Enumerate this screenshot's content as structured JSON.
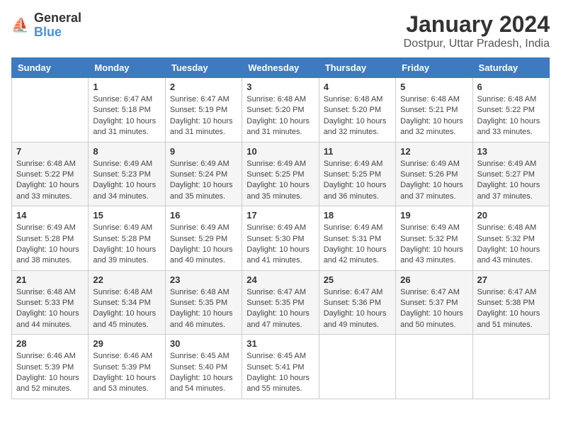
{
  "logo": {
    "text_general": "General",
    "text_blue": "Blue"
  },
  "title": "January 2024",
  "subtitle": "Dostpur, Uttar Pradesh, India",
  "headers": [
    "Sunday",
    "Monday",
    "Tuesday",
    "Wednesday",
    "Thursday",
    "Friday",
    "Saturday"
  ],
  "weeks": [
    {
      "days": [
        {
          "number": "",
          "info": ""
        },
        {
          "number": "1",
          "info": "Sunrise: 6:47 AM\nSunset: 5:18 PM\nDaylight: 10 hours and 31 minutes."
        },
        {
          "number": "2",
          "info": "Sunrise: 6:47 AM\nSunset: 5:19 PM\nDaylight: 10 hours and 31 minutes."
        },
        {
          "number": "3",
          "info": "Sunrise: 6:48 AM\nSunset: 5:20 PM\nDaylight: 10 hours and 31 minutes."
        },
        {
          "number": "4",
          "info": "Sunrise: 6:48 AM\nSunset: 5:20 PM\nDaylight: 10 hours and 32 minutes."
        },
        {
          "number": "5",
          "info": "Sunrise: 6:48 AM\nSunset: 5:21 PM\nDaylight: 10 hours and 32 minutes."
        },
        {
          "number": "6",
          "info": "Sunrise: 6:48 AM\nSunset: 5:22 PM\nDaylight: 10 hours and 33 minutes."
        }
      ]
    },
    {
      "days": [
        {
          "number": "7",
          "info": "Sunrise: 6:48 AM\nSunset: 5:22 PM\nDaylight: 10 hours and 33 minutes."
        },
        {
          "number": "8",
          "info": "Sunrise: 6:49 AM\nSunset: 5:23 PM\nDaylight: 10 hours and 34 minutes."
        },
        {
          "number": "9",
          "info": "Sunrise: 6:49 AM\nSunset: 5:24 PM\nDaylight: 10 hours and 35 minutes."
        },
        {
          "number": "10",
          "info": "Sunrise: 6:49 AM\nSunset: 5:25 PM\nDaylight: 10 hours and 35 minutes."
        },
        {
          "number": "11",
          "info": "Sunrise: 6:49 AM\nSunset: 5:25 PM\nDaylight: 10 hours and 36 minutes."
        },
        {
          "number": "12",
          "info": "Sunrise: 6:49 AM\nSunset: 5:26 PM\nDaylight: 10 hours and 37 minutes."
        },
        {
          "number": "13",
          "info": "Sunrise: 6:49 AM\nSunset: 5:27 PM\nDaylight: 10 hours and 37 minutes."
        }
      ]
    },
    {
      "days": [
        {
          "number": "14",
          "info": "Sunrise: 6:49 AM\nSunset: 5:28 PM\nDaylight: 10 hours and 38 minutes."
        },
        {
          "number": "15",
          "info": "Sunrise: 6:49 AM\nSunset: 5:28 PM\nDaylight: 10 hours and 39 minutes."
        },
        {
          "number": "16",
          "info": "Sunrise: 6:49 AM\nSunset: 5:29 PM\nDaylight: 10 hours and 40 minutes."
        },
        {
          "number": "17",
          "info": "Sunrise: 6:49 AM\nSunset: 5:30 PM\nDaylight: 10 hours and 41 minutes."
        },
        {
          "number": "18",
          "info": "Sunrise: 6:49 AM\nSunset: 5:31 PM\nDaylight: 10 hours and 42 minutes."
        },
        {
          "number": "19",
          "info": "Sunrise: 6:49 AM\nSunset: 5:32 PM\nDaylight: 10 hours and 43 minutes."
        },
        {
          "number": "20",
          "info": "Sunrise: 6:48 AM\nSunset: 5:32 PM\nDaylight: 10 hours and 43 minutes."
        }
      ]
    },
    {
      "days": [
        {
          "number": "21",
          "info": "Sunrise: 6:48 AM\nSunset: 5:33 PM\nDaylight: 10 hours and 44 minutes."
        },
        {
          "number": "22",
          "info": "Sunrise: 6:48 AM\nSunset: 5:34 PM\nDaylight: 10 hours and 45 minutes."
        },
        {
          "number": "23",
          "info": "Sunrise: 6:48 AM\nSunset: 5:35 PM\nDaylight: 10 hours and 46 minutes."
        },
        {
          "number": "24",
          "info": "Sunrise: 6:47 AM\nSunset: 5:35 PM\nDaylight: 10 hours and 47 minutes."
        },
        {
          "number": "25",
          "info": "Sunrise: 6:47 AM\nSunset: 5:36 PM\nDaylight: 10 hours and 49 minutes."
        },
        {
          "number": "26",
          "info": "Sunrise: 6:47 AM\nSunset: 5:37 PM\nDaylight: 10 hours and 50 minutes."
        },
        {
          "number": "27",
          "info": "Sunrise: 6:47 AM\nSunset: 5:38 PM\nDaylight: 10 hours and 51 minutes."
        }
      ]
    },
    {
      "days": [
        {
          "number": "28",
          "info": "Sunrise: 6:46 AM\nSunset: 5:39 PM\nDaylight: 10 hours and 52 minutes."
        },
        {
          "number": "29",
          "info": "Sunrise: 6:46 AM\nSunset: 5:39 PM\nDaylight: 10 hours and 53 minutes."
        },
        {
          "number": "30",
          "info": "Sunrise: 6:45 AM\nSunset: 5:40 PM\nDaylight: 10 hours and 54 minutes."
        },
        {
          "number": "31",
          "info": "Sunrise: 6:45 AM\nSunset: 5:41 PM\nDaylight: 10 hours and 55 minutes."
        },
        {
          "number": "",
          "info": ""
        },
        {
          "number": "",
          "info": ""
        },
        {
          "number": "",
          "info": ""
        }
      ]
    }
  ]
}
